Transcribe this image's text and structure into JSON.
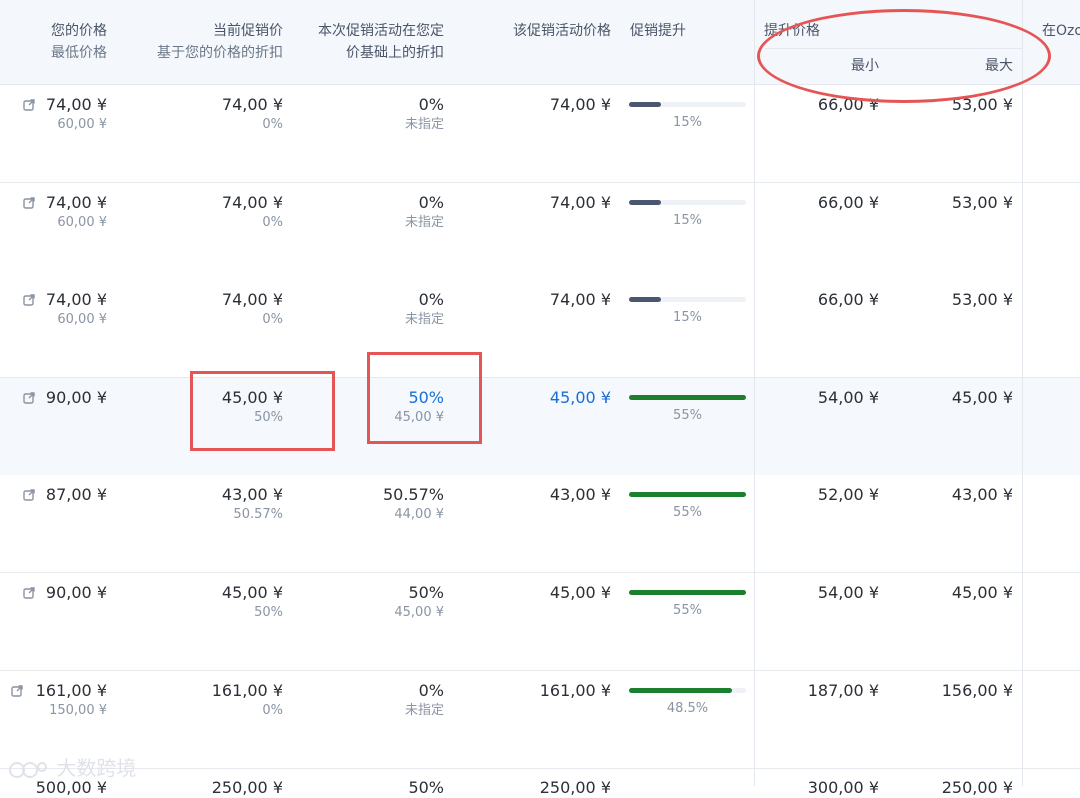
{
  "header": {
    "your_price": "您的价格",
    "min_price": "最低价格",
    "current_promo": "当前促销价",
    "current_promo_sub": "基于您的价格的折扣",
    "this_promo_l1": "本次促销活动在您定",
    "this_promo_l2": "价基础上的折扣",
    "promo_price": "该促销活动价格",
    "promo_boost": "促销提升",
    "boost_price": "提升价格",
    "min": "最小",
    "max": "最大",
    "ozon_partial": "在Ozo"
  },
  "rows": [
    {
      "price": "74,00 ¥",
      "min_price": "60,00 ¥",
      "cur": "74,00 ¥",
      "cur_pct": "0%",
      "disc": "0%",
      "disc_sub": "未指定",
      "promo": "74,00 ¥",
      "boost": "15%",
      "boost_value": 0.27,
      "boost_color": "#4b5670",
      "bmin": "66,00 ¥",
      "bmax": "53,00 ¥"
    },
    {
      "price": "74,00 ¥",
      "min_price": "60,00 ¥",
      "cur": "74,00 ¥",
      "cur_pct": "0%",
      "disc": "0%",
      "disc_sub": "未指定",
      "promo": "74,00 ¥",
      "boost": "15%",
      "boost_value": 0.27,
      "boost_color": "#4b5670",
      "bmin": "66,00 ¥",
      "bmax": "53,00 ¥"
    },
    {
      "price": "74,00 ¥",
      "min_price": "60,00 ¥",
      "cur": "74,00 ¥",
      "cur_pct": "0%",
      "disc": "0%",
      "disc_sub": "未指定",
      "promo": "74,00 ¥",
      "boost": "15%",
      "boost_value": 0.27,
      "boost_color": "#4b5670",
      "bmin": "66,00 ¥",
      "bmax": "53,00 ¥"
    },
    {
      "price": "90,00 ¥",
      "min_price": "",
      "cur": "45,00 ¥",
      "cur_pct": "50%",
      "disc": "50%",
      "disc_sub": "45,00 ¥",
      "promo": "45,00 ¥",
      "boost": "55%",
      "boost_value": 1.0,
      "boost_color": "#1b7f2e",
      "bmin": "54,00 ¥",
      "bmax": "45,00 ¥",
      "highlight": true
    },
    {
      "price": "87,00 ¥",
      "min_price": "",
      "cur": "43,00 ¥",
      "cur_pct": "50.57%",
      "disc": "50.57%",
      "disc_sub": "44,00 ¥",
      "promo": "43,00 ¥",
      "boost": "55%",
      "boost_value": 1.0,
      "boost_color": "#1b7f2e",
      "bmin": "52,00 ¥",
      "bmax": "43,00 ¥"
    },
    {
      "price": "90,00 ¥",
      "min_price": "",
      "cur": "45,00 ¥",
      "cur_pct": "50%",
      "disc": "50%",
      "disc_sub": "45,00 ¥",
      "promo": "45,00 ¥",
      "boost": "55%",
      "boost_value": 1.0,
      "boost_color": "#1b7f2e",
      "bmin": "54,00 ¥",
      "bmax": "45,00 ¥"
    },
    {
      "price": "161,00 ¥",
      "min_price": "150,00 ¥",
      "cur": "161,00 ¥",
      "cur_pct": "0%",
      "disc": "0%",
      "disc_sub": "未指定",
      "promo": "161,00 ¥",
      "boost": "48.5%",
      "boost_value": 0.88,
      "boost_color": "#1b7f2e",
      "bmin": "187,00 ¥",
      "bmax": "156,00 ¥"
    }
  ],
  "partial_row": {
    "price": "500,00 ¥",
    "cur": "250,00 ¥",
    "disc": "50%",
    "promo": "250,00 ¥",
    "bmin": "300,00 ¥",
    "bmax": "250,00 ¥"
  },
  "watermark": "大数跨境",
  "colors": {
    "annotation_red": "#e65555",
    "link_blue": "#1a6fd4",
    "bar_green": "#1b7f2e",
    "bar_dark": "#4b5670"
  }
}
